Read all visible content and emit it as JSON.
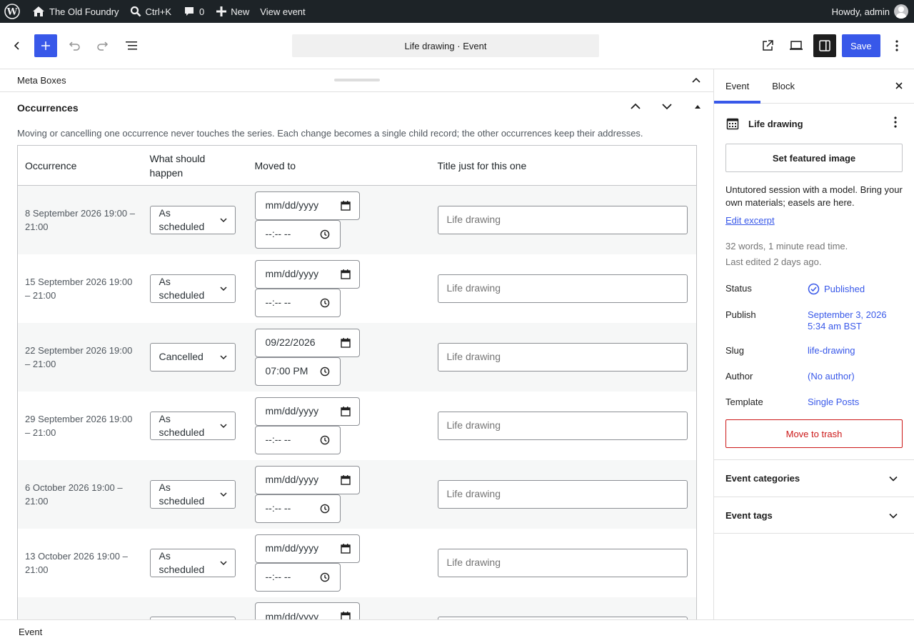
{
  "adminbar": {
    "site_name": "The Old Foundry",
    "search_label": "Ctrl+K",
    "comments_count": "0",
    "new_label": "New",
    "view_label": "View event",
    "howdy": "Howdy, admin"
  },
  "header": {
    "doc_title": "Life drawing · Event",
    "save_label": "Save"
  },
  "metabox": {
    "title": "Meta Boxes"
  },
  "occurrences": {
    "title": "Occurrences",
    "description": "Moving or cancelling one occurrence never touches the series. Each change becomes a single child record; the other occurrences keep their addresses.",
    "columns": [
      "Occurrence",
      "What should happen",
      "Moved to",
      "Title just for this one"
    ],
    "rows": [
      {
        "when": "8 September 2026 19:00 – 21:00",
        "action": "As scheduled",
        "date": "mm/dd/yyyy",
        "time": "--:-- --",
        "title_placeholder": "Life drawing"
      },
      {
        "when": "15 September 2026 19:00 – 21:00",
        "action": "As scheduled",
        "date": "mm/dd/yyyy",
        "time": "--:-- --",
        "title_placeholder": "Life drawing"
      },
      {
        "when": "22 September 2026 19:00 – 21:00",
        "action": "Cancelled",
        "date": "09/22/2026",
        "time": "07:00 PM",
        "title_placeholder": "Life drawing"
      },
      {
        "when": "29 September 2026 19:00 – 21:00",
        "action": "As scheduled",
        "date": "mm/dd/yyyy",
        "time": "--:-- --",
        "title_placeholder": "Life drawing"
      },
      {
        "when": "6 October 2026 19:00 – 21:00",
        "action": "As scheduled",
        "date": "mm/dd/yyyy",
        "time": "--:-- --",
        "title_placeholder": "Life drawing"
      },
      {
        "when": "13 October 2026 19:00 – 21:00",
        "action": "As scheduled",
        "date": "mm/dd/yyyy",
        "time": "--:-- --",
        "title_placeholder": "Life drawing"
      },
      {
        "when": "",
        "action": "",
        "date": "mm/dd/yyyy",
        "time": "",
        "title_placeholder": ""
      }
    ]
  },
  "footer": {
    "breadcrumb": "Event"
  },
  "sidebar": {
    "tab_event": "Event",
    "tab_block": "Block",
    "post_name": "Life drawing",
    "featured_label": "Set featured image",
    "excerpt": "Untutored session with a model. Bring your own materials; easels are here.",
    "edit_excerpt": "Edit excerpt",
    "word_count": "32 words, 1 minute read time.",
    "last_edited": "Last edited 2 days ago.",
    "status_label": "Status",
    "status_value": "Published",
    "publish_label": "Publish",
    "publish_line1": "September 3, 2026",
    "publish_line2": "5:34 am BST",
    "slug_label": "Slug",
    "slug_value": "life-drawing",
    "author_label": "Author",
    "author_value": "(No author)",
    "template_label": "Template",
    "template_value": "Single Posts",
    "trash_label": "Move to trash",
    "categories_label": "Event categories",
    "tags_label": "Event tags"
  }
}
